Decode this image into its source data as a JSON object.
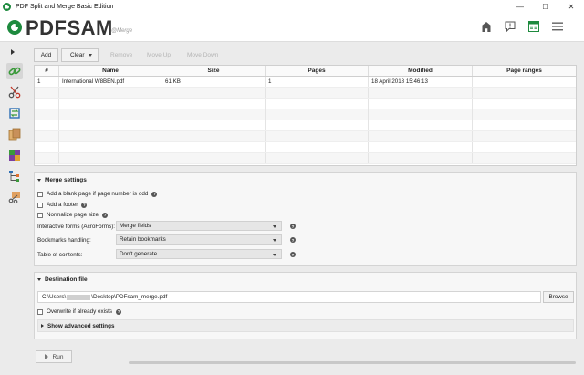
{
  "window": {
    "title": "PDF Split and Merge Basic Edition",
    "minimize": "—",
    "maximize": "☐",
    "close": "✕"
  },
  "header": {
    "logo": "PDFSAM",
    "module": "@Merge",
    "icons": [
      "home-icon",
      "news-icon",
      "modules-icon",
      "menu-icon"
    ]
  },
  "sidebar": {
    "items": [
      {
        "name": "merge",
        "active": true
      },
      {
        "name": "split",
        "active": false
      },
      {
        "name": "rotate",
        "active": false
      },
      {
        "name": "extract",
        "active": false
      },
      {
        "name": "alternate-mix",
        "active": false
      },
      {
        "name": "split-by-bookmarks",
        "active": false
      },
      {
        "name": "split-by-size",
        "active": false
      }
    ]
  },
  "toolbar": {
    "add_label": "Add",
    "clear_label": "Clear",
    "remove_label": "Remove",
    "move_up_label": "Move Up",
    "move_down_label": "Move Down"
  },
  "table": {
    "columns": [
      "#",
      "Name",
      "Size",
      "Pages",
      "Modified",
      "Page ranges"
    ],
    "rows": [
      {
        "index": "1",
        "name": "International W8BEN.pdf",
        "size": "61 KB",
        "pages": "1",
        "modified": "18 April 2018 15:46:13",
        "ranges": ""
      }
    ]
  },
  "merge_settings": {
    "title": "Merge settings",
    "blank_page_label": "Add a blank page if page number is odd",
    "footer_label": "Add a footer",
    "normalize_label": "Normalize page size",
    "forms_label": "Interactive forms (AcroForms):",
    "forms_value": "Merge fields",
    "bookmarks_label": "Bookmarks handling:",
    "bookmarks_value": "Retain bookmarks",
    "toc_label": "Table of contents:",
    "toc_value": "Don't generate"
  },
  "destination": {
    "title": "Destination file",
    "path_prefix": "C:\\Users\\",
    "path_suffix": "\\Desktop\\PDFsam_merge.pdf",
    "browse_label": "Browse",
    "overwrite_label": "Overwrite if already exists",
    "advanced_label": "Show advanced settings"
  },
  "footer": {
    "run_label": "Run"
  },
  "colors": {
    "brand_green": "#1e8a3e",
    "background": "#ebebeb"
  }
}
